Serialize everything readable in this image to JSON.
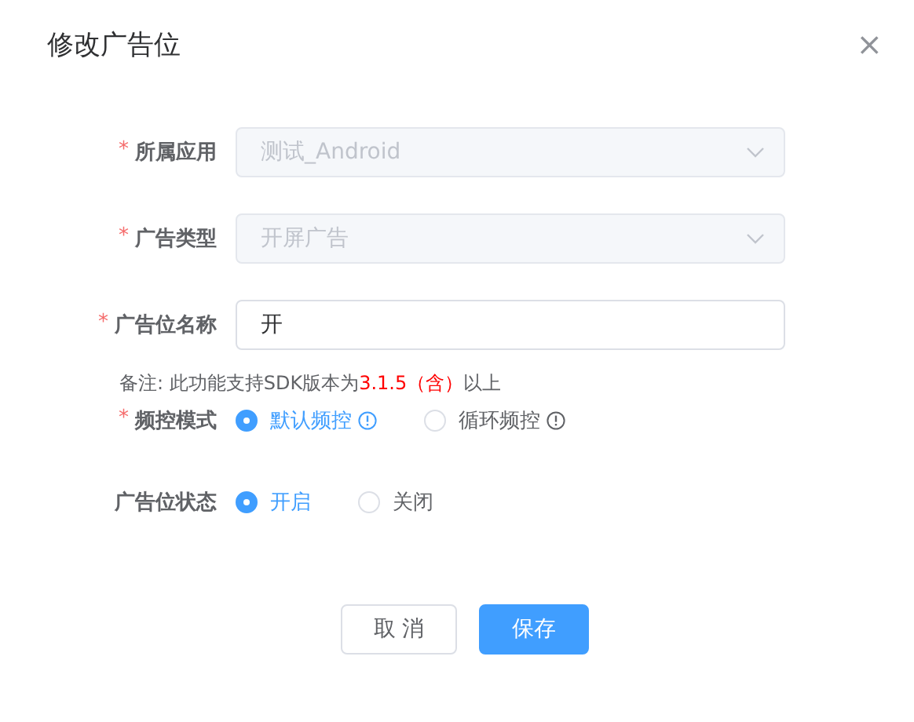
{
  "dialog": {
    "title": "修改广告位",
    "close": "×"
  },
  "fields": [
    {
      "kind": "select",
      "label": "所属应用",
      "required_mark": "*",
      "value": "测试_Android",
      "disabled": true
    },
    {
      "kind": "select",
      "label": "广告类型",
      "required_mark": "*",
      "value": "开屏广告",
      "disabled": true
    },
    {
      "kind": "input",
      "label": "广告位名称",
      "required_mark": "*",
      "value": "开",
      "disabled": false
    }
  ],
  "note": {
    "prefix": "备注: 此功能支持SDK版本为",
    "highlight": "3.1.5（含）",
    "suffix": "以上"
  },
  "radio_groups": [
    {
      "label": "频控模式",
      "required_mark": "*",
      "options": [
        {
          "label": "默认频控",
          "selected": true,
          "info": true
        },
        {
          "label": "循环频控",
          "selected": false,
          "info": true
        }
      ]
    },
    {
      "label": "广告位状态",
      "options": [
        {
          "label": "开启",
          "selected": true,
          "info": false
        },
        {
          "label": "关闭",
          "selected": false,
          "info": false
        }
      ]
    }
  ],
  "buttons": [
    {
      "label": "取 消",
      "kind": "default"
    },
    {
      "label": "保存",
      "kind": "primary"
    }
  ]
}
